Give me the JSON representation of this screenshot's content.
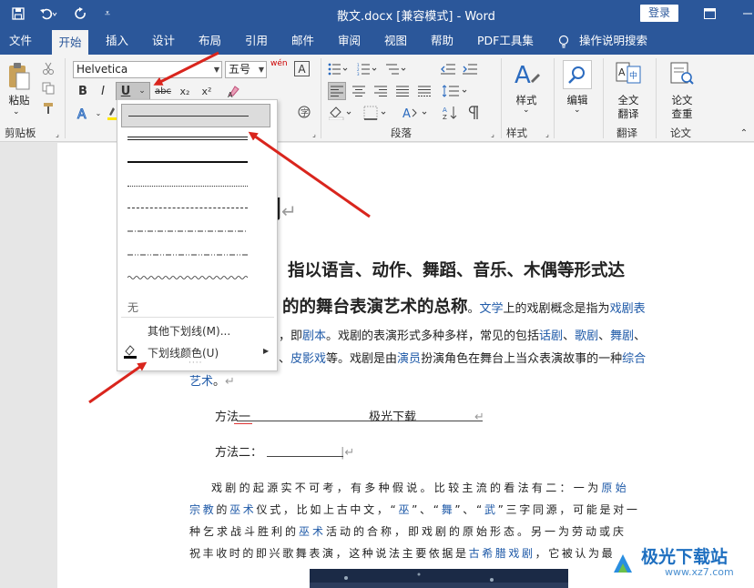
{
  "window": {
    "title": "散文.docx [兼容模式]  -  Word",
    "login_label": "登录"
  },
  "tabs": [
    "文件",
    "开始",
    "插入",
    "设计",
    "布局",
    "引用",
    "邮件",
    "审阅",
    "视图",
    "帮助",
    "PDF工具集",
    "操作说明搜索"
  ],
  "ribbon": {
    "paste_label": "粘贴",
    "clipboard_label": "剪贴板",
    "font_name": "Helvetica",
    "font_size": "五号",
    "wen_label": "wén",
    "bold": "B",
    "italic": "I",
    "underline": "U",
    "strike": "abc",
    "sub": "x₂",
    "sup": "x²",
    "paragraph_label": "段落",
    "styles_btn": "样式",
    "styles_label": "样式",
    "edit_btn": "编辑",
    "translate_btn_1": "全文",
    "translate_btn_2": "翻译",
    "translate_label": "翻译",
    "review_btn_1": "论文",
    "review_btn_2": "查重",
    "review_label": "论文"
  },
  "document": {
    "heading": "剧",
    "line1": "指以语言、动作、舞蹈、音乐、木偶等形式达",
    "line2_bold": "的的舞台表演艺术的总称",
    "line2_a": "。",
    "line2_link1": "文学",
    "line2_b": "上的戏剧概念是指为",
    "line2_link2": "戏剧表",
    "line3_a": "，即",
    "line3_link1": "剧本",
    "line3_b": "。戏剧的表演形式多种多样，常见的包括",
    "line3_link2": "话剧",
    "line3_sep1": "、",
    "line3_link3": "歌剧",
    "line3_sep2": "、",
    "line3_link4": "舞剧",
    "line3_sep3": "、",
    "line4_sep": "、",
    "line4_link1": "皮影戏",
    "line4_a": "等。戏剧是由",
    "line4_link2": "演员",
    "line4_b": "扮演角色在舞台上当众表演故事的一种",
    "line4_link3": "综合",
    "line5_link": "艺术",
    "line5_a": "。",
    "method1": "方法一",
    "method1_text": "极光下载",
    "method2": "方法二：",
    "p2_line1_a": "戏剧的起源实不可考，有多种假说。比较主流的看法有二：一为",
    "p2_line1_link": "原始",
    "p2_line2_link1": "宗教",
    "p2_line2_a": "的",
    "p2_line2_link2": "巫术",
    "p2_line2_b": "仪式，比如上古中文，“",
    "p2_line2_link3": "巫",
    "p2_line2_c": "”、“",
    "p2_line2_link4": "舞",
    "p2_line2_d": "”、“",
    "p2_line2_link5": "武",
    "p2_line2_e": "”三字同源，可能是对一",
    "p2_line3_a": "种乞求战斗胜利的",
    "p2_line3_link": "巫术",
    "p2_line3_b": "活动的合称，即戏剧的原始形态。另一为劳动或庆",
    "p2_line4_a": "祝丰收时的即兴歌舞表演，这种说法主要依据是",
    "p2_line4_link": "古希腊戏剧",
    "p2_line4_b": "，它被认为最"
  },
  "dropdown": {
    "none_label": "无",
    "more_label": "其他下划线(M)...",
    "color_label": "下划线颜色(U)"
  },
  "watermark": {
    "brand": "极光下载站",
    "url": "www.xz7.com"
  },
  "colors": {
    "titlebar": "#2b579a",
    "link": "#1f5aa8",
    "arrow": "#d9251d"
  }
}
